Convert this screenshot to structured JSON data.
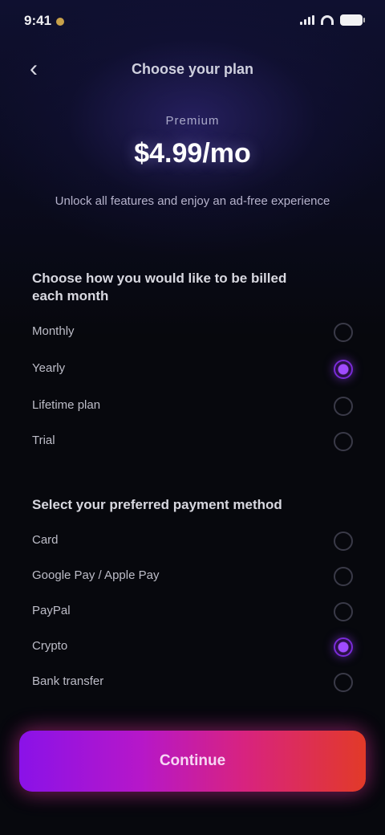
{
  "status_bar": {
    "time": "9:41"
  },
  "header": {
    "title": "Choose your plan",
    "back_icon": "back-arrow-icon"
  },
  "hero": {
    "kicker": "Premium",
    "price": "$4.99/mo",
    "subtitle": "Unlock all features and enjoy an ad-free experience"
  },
  "sections": [
    {
      "title": "Choose how you would like to be billed each month",
      "options": [
        {
          "label": "Monthly",
          "selected": false
        },
        {
          "label": "Yearly",
          "selected": true
        },
        {
          "label": "Lifetime plan",
          "selected": false
        },
        {
          "label": "Trial",
          "selected": false
        }
      ]
    },
    {
      "title": "Select your preferred payment method",
      "options": [
        {
          "label": "Card",
          "selected": false
        },
        {
          "label": "Google Pay / Apple Pay",
          "selected": false
        },
        {
          "label": "PayPal",
          "selected": false
        },
        {
          "label": "Crypto",
          "selected": true
        },
        {
          "label": "Bank transfer",
          "selected": false
        }
      ]
    }
  ],
  "cta": {
    "label": "Continue"
  },
  "colors": {
    "accent_start": "#8a12e8",
    "accent_end": "#e23a28",
    "radio_selected": "#a04bff"
  }
}
